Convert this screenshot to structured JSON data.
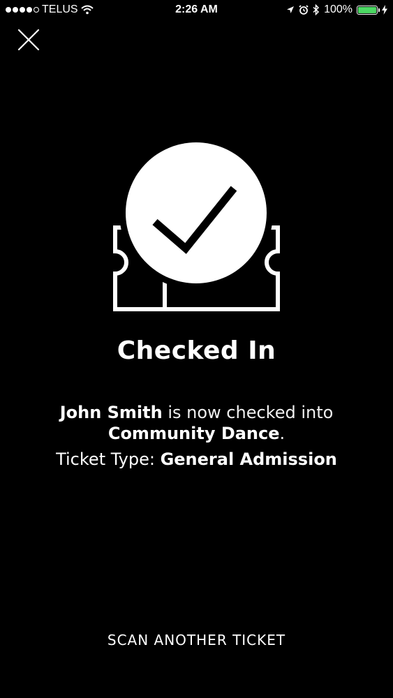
{
  "status_bar": {
    "carrier": "TELUS",
    "time": "2:26 AM",
    "battery_percent": "100%",
    "battery_level": 1.0,
    "battery_color": "#4cd964",
    "signal_bars_filled": 4,
    "signal_bars_total": 5
  },
  "close": {
    "icon": "close-icon"
  },
  "illustration": {
    "icon": "checked-ticket-icon"
  },
  "title": "Checked In",
  "message": {
    "attendee_name": "John Smith",
    "middle_text": " is now checked into",
    "event_name": "Community Dance",
    "end_punct": "."
  },
  "ticket_type": {
    "label": "Ticket Type: ",
    "value": "General Admission"
  },
  "actions": {
    "scan_another_label": "SCAN ANOTHER TICKET"
  },
  "colors": {
    "background": "#000000",
    "foreground": "#ffffff"
  }
}
